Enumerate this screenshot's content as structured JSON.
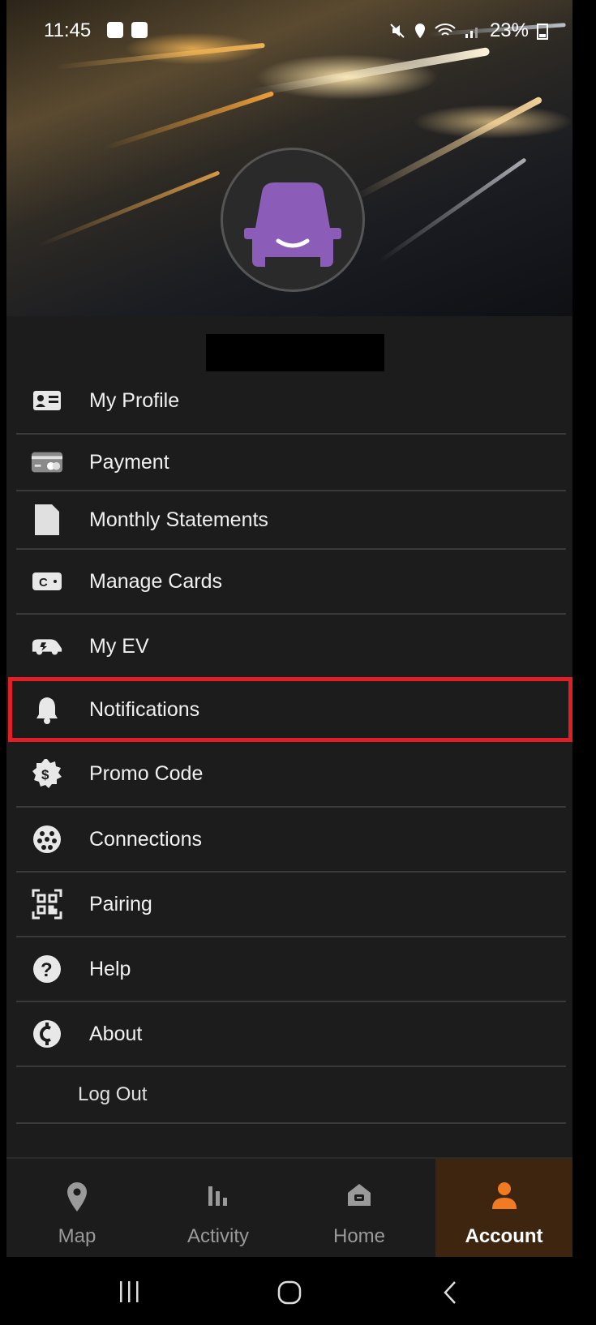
{
  "status_bar": {
    "time": "11:45",
    "battery": "23%"
  },
  "menu": {
    "items": [
      {
        "label": "My Profile",
        "icon": "id-card-icon"
      },
      {
        "label": "Payment",
        "icon": "credit-card-icon"
      },
      {
        "label": "Monthly Statements",
        "icon": "document-icon"
      },
      {
        "label": "Manage Cards",
        "icon": "charge-card-icon"
      },
      {
        "label": "My EV",
        "icon": "ev-car-icon"
      },
      {
        "label": "Notifications",
        "icon": "bell-icon"
      },
      {
        "label": "Promo Code",
        "icon": "promo-badge-icon"
      },
      {
        "label": "Connections",
        "icon": "connector-icon"
      },
      {
        "label": "Pairing",
        "icon": "qr-code-icon"
      },
      {
        "label": "Help",
        "icon": "help-icon"
      },
      {
        "label": "About",
        "icon": "about-logo-icon"
      }
    ],
    "logout_label": "Log Out"
  },
  "nav": {
    "tabs": [
      {
        "label": "Map",
        "icon": "map-pin-icon"
      },
      {
        "label": "Activity",
        "icon": "bar-chart-icon"
      },
      {
        "label": "Home",
        "icon": "home-charger-icon"
      },
      {
        "label": "Account",
        "icon": "person-icon"
      }
    ],
    "active_tab": "Account"
  },
  "colors": {
    "accent": "#f07b22",
    "highlight_border": "#e01f27",
    "avatar_car": "#8b5cb8"
  }
}
